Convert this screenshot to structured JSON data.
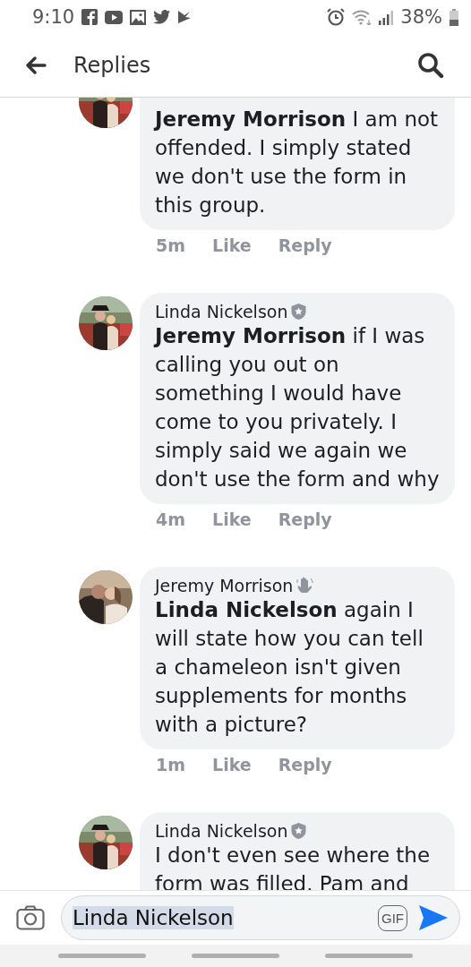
{
  "status_bar": {
    "time": "9:10",
    "battery": "38%"
  },
  "header": {
    "title": "Replies"
  },
  "comments": [
    {
      "kind": "clipped",
      "text": "**Jeremy Morrison** I am not offended. I simply stated we don't use the form in this group.",
      "time": "5m",
      "actions": [
        "Like",
        "Reply"
      ]
    },
    {
      "kind": "admin",
      "author": "Linda Nickelson",
      "text": "**Jeremy Morrison** if I was calling you out on something I would have come to you privately. I simply said we again we don't use the form and why",
      "time": "4m",
      "actions": [
        "Like",
        "Reply"
      ]
    },
    {
      "kind": "wave",
      "author": "Jeremy Morrison",
      "text": "**Linda Nickelson** again I will state how you can tell a chameleon isn't given supplements for months with a picture?",
      "time": "1m",
      "actions": [
        "Like",
        "Reply"
      ]
    },
    {
      "kind": "admin",
      "author": "Linda Nickelson",
      "text": "I don't even see where the form was filled. Pam and"
    }
  ],
  "composer": {
    "value": "Linda Nickelson",
    "text_selected": true,
    "gif_label": "GIF"
  }
}
